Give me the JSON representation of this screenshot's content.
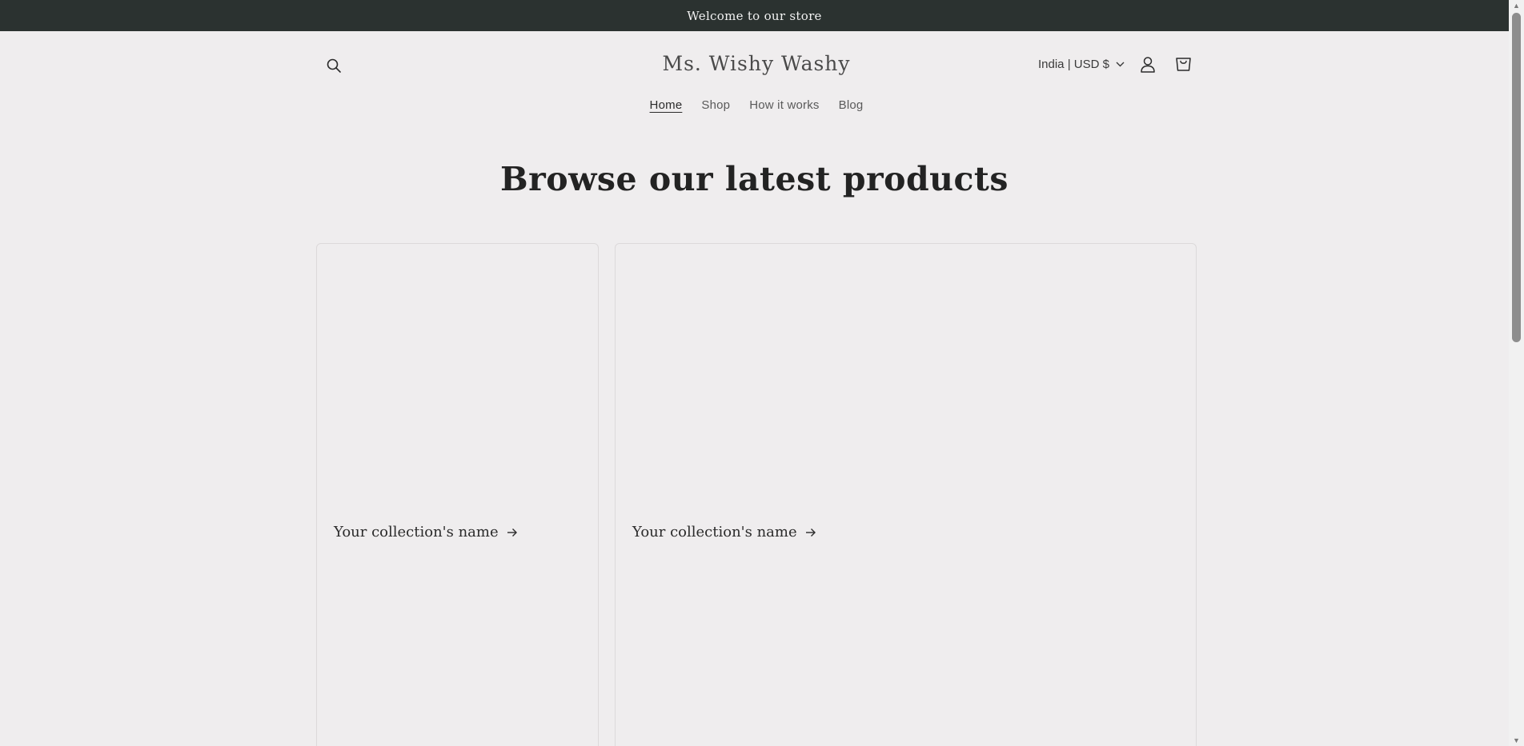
{
  "announcement": {
    "text": "Welcome to our store"
  },
  "header": {
    "logo": "Ms. Wishy Washy",
    "country_selector": "India | USD $",
    "nav": [
      {
        "label": "Home",
        "active": true
      },
      {
        "label": "Shop",
        "active": false
      },
      {
        "label": "How it works",
        "active": false
      },
      {
        "label": "Blog",
        "active": false
      }
    ]
  },
  "main": {
    "headline": "Browse our latest products",
    "collections": [
      {
        "title": "Your collection's name"
      },
      {
        "title": "Your collection's name"
      }
    ]
  },
  "icons": {
    "search": "search-icon",
    "account": "account-icon",
    "cart": "cart-icon",
    "country_chevron": "chevron-down-icon",
    "collection_arrow": "arrow-right-icon"
  },
  "colors": {
    "announcement_bg": "#2b3230",
    "page_bg": "#efedee"
  }
}
